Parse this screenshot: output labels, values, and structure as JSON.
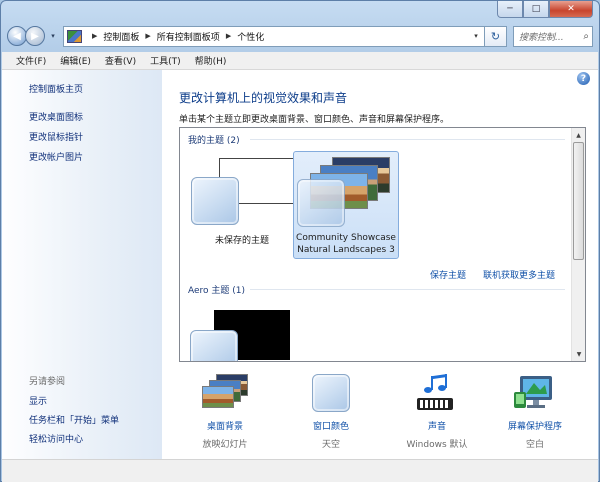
{
  "window": {
    "minimize": "─",
    "maximize": "□",
    "close": "✕"
  },
  "address": {
    "breadcrumb": [
      "控制面板",
      "所有控制面板项",
      "个性化"
    ],
    "dropdown_glyph": "▾",
    "refresh_glyph": "↻",
    "search_placeholder": "搜索控制..."
  },
  "menu": [
    "文件(F)",
    "编辑(E)",
    "查看(V)",
    "工具(T)",
    "帮助(H)"
  ],
  "sidebar": {
    "home": "控制面板主页",
    "links": [
      "更改桌面图标",
      "更改鼠标指针",
      "更改帐户图片"
    ],
    "see_also_title": "另请参阅",
    "see_also": [
      "显示",
      "任务栏和「开始」菜单",
      "轻松访问中心"
    ]
  },
  "main": {
    "title": "更改计算机上的视觉效果和声音",
    "description": "单击某个主题立即更改桌面背景、窗口颜色、声音和屏幕保护程序。",
    "my_themes_header": "我的主题 (2)",
    "themes": [
      {
        "name": "未保存的主题"
      },
      {
        "name_line1": "Community Showcase",
        "name_line2": "Natural Landscapes 3"
      }
    ],
    "save_theme": "保存主题",
    "get_more": "联机获取更多主题",
    "aero_header": "Aero 主题 (1)"
  },
  "bottom": [
    {
      "label": "桌面背景",
      "sub": "放映幻灯片",
      "icon": "desktop-background-icon"
    },
    {
      "label": "窗口颜色",
      "sub": "天空",
      "icon": "window-color-icon"
    },
    {
      "label": "声音",
      "sub": "Windows 默认",
      "icon": "sound-icon"
    },
    {
      "label": "屏幕保护程序",
      "sub": "空白",
      "icon": "screensaver-icon"
    }
  ],
  "colors": {
    "link": "#1151a8",
    "title": "#0d3d8a",
    "selection": "#cadff7"
  }
}
